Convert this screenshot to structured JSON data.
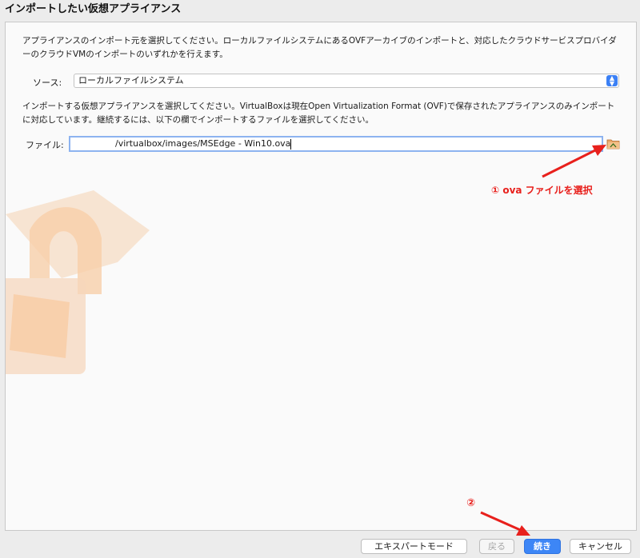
{
  "window": {
    "title": "インポートしたい仮想アプライアンス"
  },
  "main": {
    "description_source": "アプライアンスのインポート元を選択してください。ローカルファイルシステムにあるOVFアーカイブのインポートと、対応したクラウドサービスプロバイダーのクラウドVMのインポートのいずれかを行えます。",
    "source_label": "ソース:",
    "source_value": "ローカルファイルシステム",
    "description_file": "インポートする仮想アプライアンスを選択してください。VirtualBoxは現在Open Virtualization Format (OVF)で保存されたアプライアンスのみインポートに対応しています。継続するには、以下の欄でインポートするファイルを選択してください。",
    "file_label": "ファイル:",
    "file_value": "/virtualbox/images/MSEdge - Win10.ova"
  },
  "annotations": {
    "step1": "① ova ファイルを選択",
    "step2": "②"
  },
  "buttons": {
    "expert": "エキスパートモード",
    "back": "戻る",
    "next": "続き",
    "cancel": "キャンセル"
  },
  "colors": {
    "accent": "#3d86f6",
    "annotation": "#e8201c"
  }
}
